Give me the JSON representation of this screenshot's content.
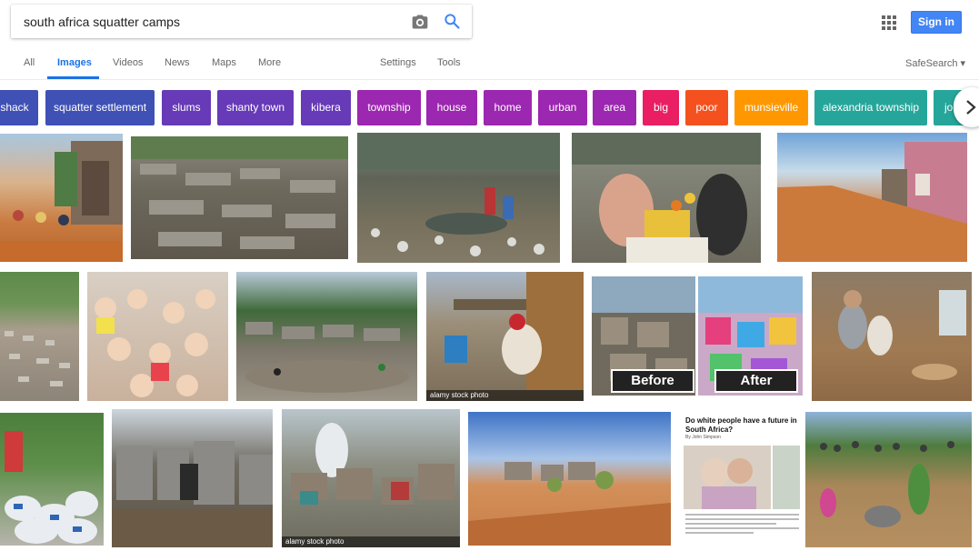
{
  "search": {
    "query": "south africa squatter camps",
    "camera_icon": "camera-icon",
    "search_icon": "search-icon"
  },
  "header": {
    "apps_icon": "apps-grid-icon",
    "sign_in": "Sign in"
  },
  "tabs": [
    {
      "label": "All",
      "active": false
    },
    {
      "label": "Images",
      "active": true
    },
    {
      "label": "Videos",
      "active": false
    },
    {
      "label": "News",
      "active": false
    },
    {
      "label": "Maps",
      "active": false
    },
    {
      "label": "More",
      "active": false
    }
  ],
  "tools": {
    "settings": "Settings",
    "tools": "Tools"
  },
  "safesearch": "SafeSearch ▾",
  "chips": [
    {
      "label": "shack",
      "color": "#3f51b5"
    },
    {
      "label": "squatter settlement",
      "color": "#3f51b5"
    },
    {
      "label": "slums",
      "color": "#673ab7"
    },
    {
      "label": "shanty town",
      "color": "#673ab7"
    },
    {
      "label": "kibera",
      "color": "#673ab7"
    },
    {
      "label": "township",
      "color": "#9c27b0"
    },
    {
      "label": "house",
      "color": "#9c27b0"
    },
    {
      "label": "home",
      "color": "#9c27b0"
    },
    {
      "label": "urban",
      "color": "#9c27b0"
    },
    {
      "label": "area",
      "color": "#9c27b0"
    },
    {
      "label": "big",
      "color": "#e91e63"
    },
    {
      "label": "poor",
      "color": "#f4511e"
    },
    {
      "label": "munsieville",
      "color": "#ff9800"
    },
    {
      "label": "alexandria township",
      "color": "#26a69a"
    },
    {
      "label": "johannesburg",
      "color": "#26a69a"
    }
  ],
  "chip_next_icon": "chevron-right-icon",
  "images": {
    "watermark": "alamy stock photo",
    "before": "Before",
    "after": "After",
    "article_title": "Do white people have a future in South Africa?",
    "article_byline": "By John Simpson"
  }
}
